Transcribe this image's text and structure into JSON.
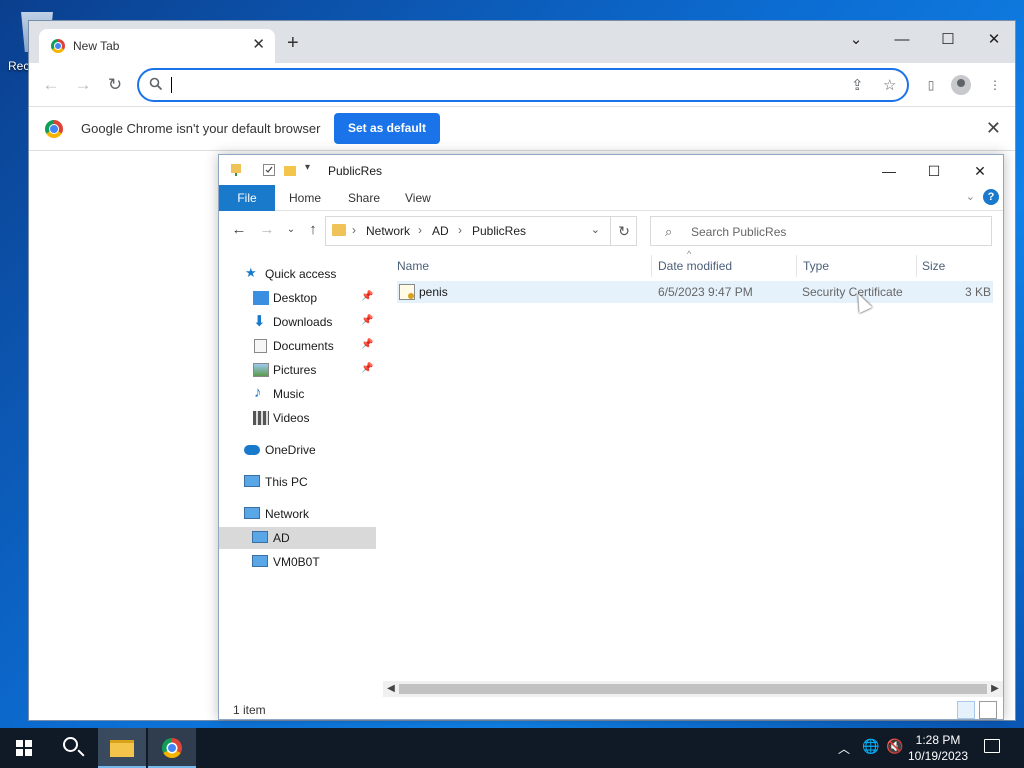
{
  "desktop": {
    "recycle_label": "Rec"
  },
  "chrome": {
    "tab_title": "New Tab",
    "tab_close": "✕",
    "new_tab": "+",
    "window_controls": {
      "tabsearch": "⌄",
      "minimize": "—",
      "maximize": "☐",
      "close": "✕"
    },
    "omnibox": {
      "value": "",
      "placeholder": ""
    },
    "infobar": {
      "message": "Google Chrome isn't your default browser",
      "button": "Set as default",
      "close": "✕"
    }
  },
  "explorer": {
    "title": "PublicRes",
    "ribbon_tabs": [
      "File",
      "Home",
      "Share",
      "View"
    ],
    "breadcrumb": [
      "Network",
      "AD",
      "PublicRes"
    ],
    "search_placeholder": "Search PublicRes",
    "nav": {
      "quick_access": "Quick access",
      "desktop": "Desktop",
      "downloads": "Downloads",
      "documents": "Documents",
      "pictures": "Pictures",
      "music": "Music",
      "videos": "Videos",
      "onedrive": "OneDrive",
      "this_pc": "This PC",
      "network": "Network",
      "ad": "AD",
      "vm": "VM0B0T"
    },
    "columns": {
      "name": "Name",
      "date": "Date modified",
      "type": "Type",
      "size": "Size"
    },
    "files": [
      {
        "name": "penis",
        "date": "6/5/2023 9:47 PM",
        "type": "Security Certificate",
        "size": "3 KB"
      }
    ],
    "status": "1 item"
  },
  "taskbar": {
    "time": "1:28 PM",
    "date": "10/19/2023"
  },
  "colors": {
    "accent": "#1a73e8",
    "explorer_file_tab": "#1979ca",
    "taskbar": "#101a27"
  }
}
